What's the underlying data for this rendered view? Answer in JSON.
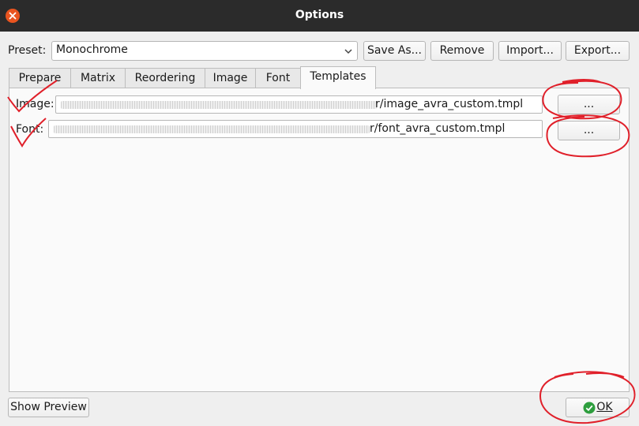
{
  "window": {
    "title": "Options"
  },
  "preset": {
    "label": "Preset:",
    "value": "Monochrome"
  },
  "toolbar": {
    "save_as": "Save As...",
    "remove": "Remove",
    "import": "Import...",
    "export": "Export..."
  },
  "tabs": [
    {
      "label": "Prepare",
      "active": false
    },
    {
      "label": "Matrix",
      "active": false
    },
    {
      "label": "Reordering",
      "active": false
    },
    {
      "label": "Image",
      "active": false
    },
    {
      "label": "Font",
      "active": false
    },
    {
      "label": "Templates",
      "active": true
    }
  ],
  "templates": {
    "image": {
      "label": "Image:",
      "path_visible": "r/image_avra_custom.tmpl",
      "browse": "..."
    },
    "font": {
      "label": "Font:",
      "path_visible": "r/font_avra_custom.tmpl",
      "browse": "..."
    }
  },
  "footer": {
    "show_preview": "Show Preview",
    "ok": "OK"
  },
  "colors": {
    "titlebar": "#2b2b2b",
    "close_button": "#e9541f",
    "annotation": "#e0202a",
    "ok_icon": "#2e9e3e"
  },
  "icons": {
    "close": "close-icon",
    "dropdown": "chevron-down-icon",
    "ok": "check-circle-icon"
  }
}
